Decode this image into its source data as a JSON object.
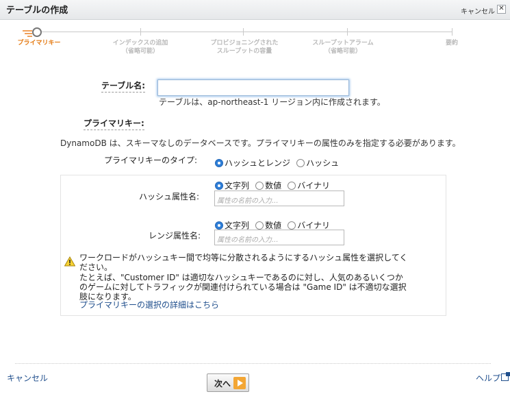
{
  "dialog": {
    "title": "テーブルの作成",
    "cancel_top": "キャンセル",
    "close_glyph": "✕"
  },
  "wizard": {
    "steps": [
      {
        "line1": "プライマリキー",
        "line2": "",
        "active": true
      },
      {
        "line1": "インデックスの追加",
        "line2": "（省略可能）",
        "active": false
      },
      {
        "line1": "プロビジョニングされた",
        "line2": "スループットの容量",
        "active": false
      },
      {
        "line1": "スループットアラーム",
        "line2": "（省略可能）",
        "active": false
      },
      {
        "line1": "要約",
        "line2": "",
        "active": false
      }
    ]
  },
  "table_name": {
    "label": "テーブル名:",
    "value": "",
    "hint": "テーブルは、ap-northeast-1 リージョン内に作成されます。"
  },
  "primary_key": {
    "label": "プライマリキー:",
    "note": "DynamoDB は、スキーマなしのデータベースです。プライマリキーの属性のみを指定する必要があります。",
    "type_label": "プライマリキーのタイプ:",
    "type_options": [
      "ハッシュとレンジ",
      "ハッシュ"
    ],
    "type_selected": "ハッシュとレンジ"
  },
  "hash_attr": {
    "label": "ハッシュ属性名:",
    "types": [
      "文字列",
      "数値",
      "バイナリ"
    ],
    "selected": "文字列",
    "placeholder": "属性の名前の入力..."
  },
  "range_attr": {
    "label": "レンジ属性名:",
    "types": [
      "文字列",
      "数値",
      "バイナリ"
    ],
    "selected": "文字列",
    "placeholder": "属性の名前の入力..."
  },
  "warning": {
    "line1": "ワークロードがハッシュキー間で均等に分散されるようにするハッシュ属性を選択してく",
    "line2": "ださい。",
    "line3": "たとえば、\"Customer ID\" は適切なハッシュキーであるのに対し、人気のあるいくつか",
    "line4": "のゲームに対してトラフィックが関連付けられている場合は \"Game ID\" は不適切な選択",
    "line5": "肢になります。",
    "link": "プライマリキーの選択の詳細はこちら"
  },
  "footer": {
    "cancel": "キャンセル",
    "next": "次へ",
    "help": "ヘルプ"
  },
  "colors": {
    "accent_orange": "#e47911",
    "link_blue": "#1f4e8c",
    "radio_blue": "#2f7fd8"
  }
}
